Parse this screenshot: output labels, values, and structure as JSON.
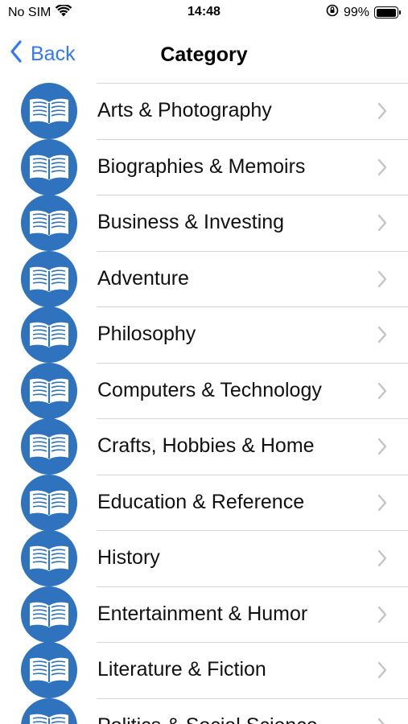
{
  "status_bar": {
    "carrier": "No SIM",
    "time": "14:48",
    "battery_percent": "99%",
    "battery_level": 0.99
  },
  "nav": {
    "back_label": "Back",
    "title": "Category"
  },
  "colors": {
    "accent": "#3478F6",
    "icon_background": "#2f73bf"
  },
  "categories": [
    {
      "label": "Arts & Photography",
      "icon": "open-book-icon"
    },
    {
      "label": "Biographies & Memoirs",
      "icon": "open-book-icon"
    },
    {
      "label": "Business & Investing",
      "icon": "open-book-icon"
    },
    {
      "label": "Adventure",
      "icon": "open-book-icon"
    },
    {
      "label": "Philosophy",
      "icon": "open-book-icon"
    },
    {
      "label": "Computers & Technology",
      "icon": "open-book-icon"
    },
    {
      "label": "Crafts, Hobbies & Home",
      "icon": "open-book-icon"
    },
    {
      "label": "Education & Reference",
      "icon": "open-book-icon"
    },
    {
      "label": "History",
      "icon": "open-book-icon"
    },
    {
      "label": "Entertainment & Humor",
      "icon": "open-book-icon"
    },
    {
      "label": "Literature & Fiction",
      "icon": "open-book-icon"
    },
    {
      "label": "Politics & Social Science",
      "icon": "open-book-icon"
    }
  ]
}
